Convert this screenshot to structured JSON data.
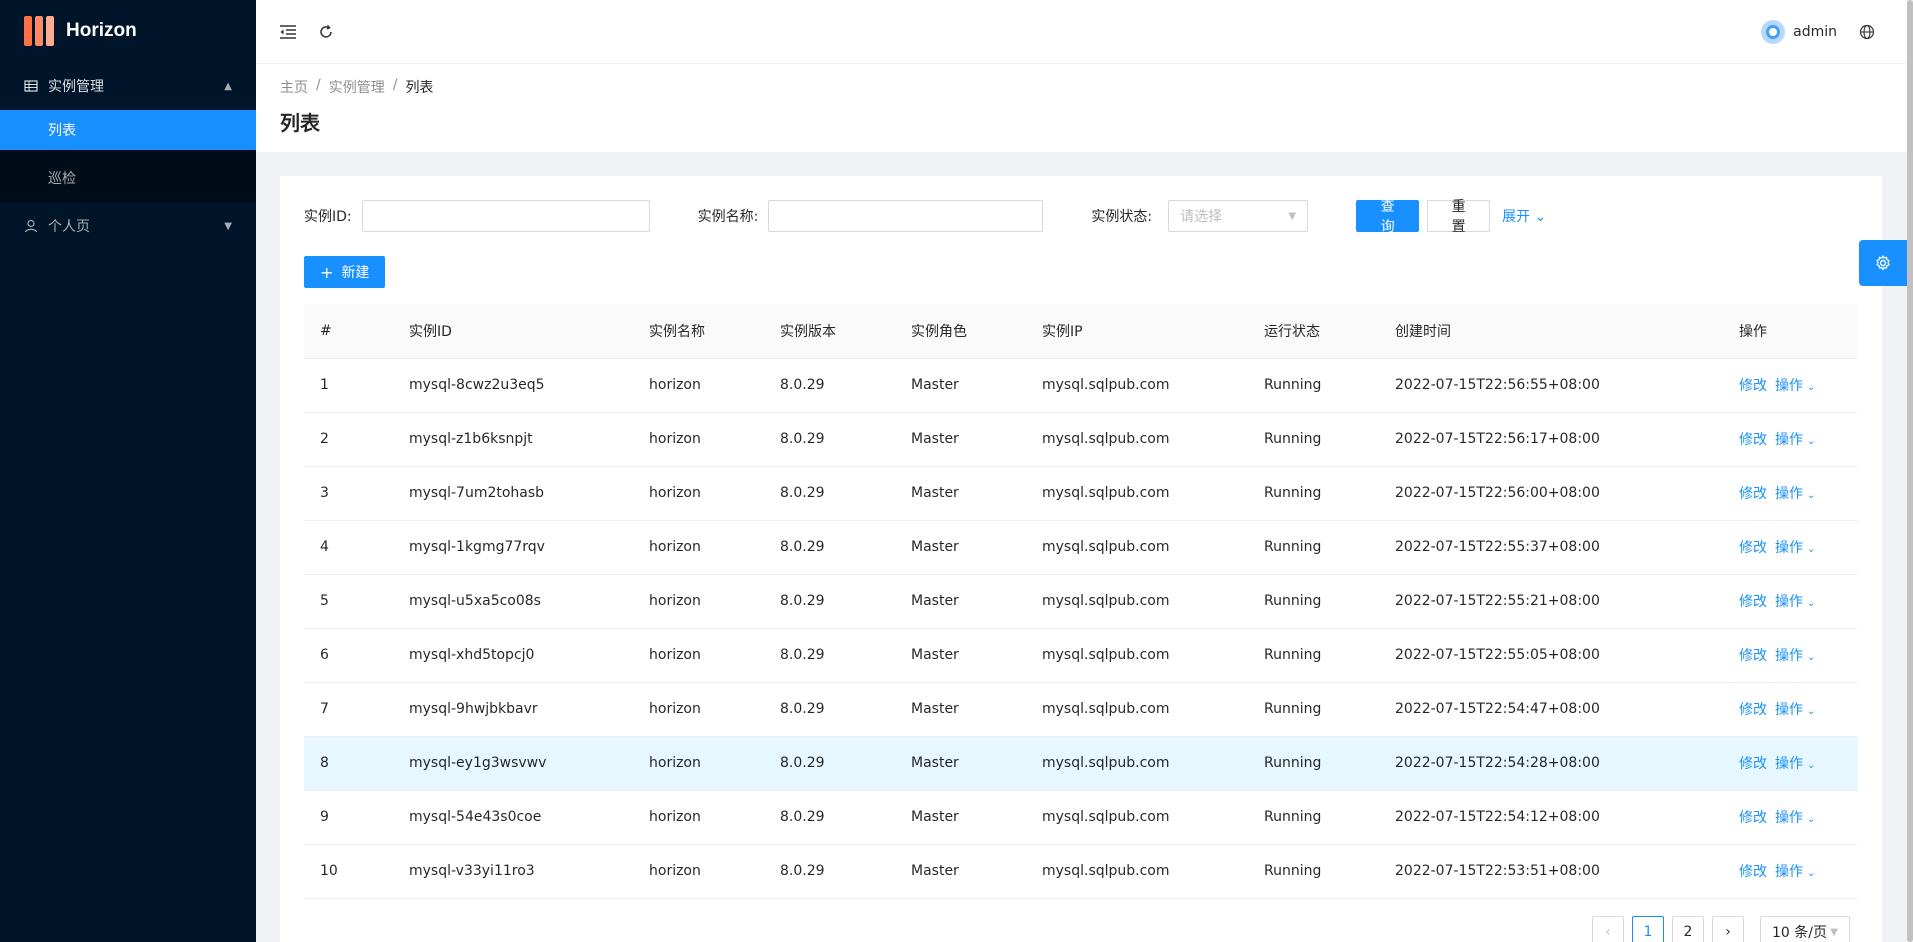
{
  "app": {
    "name": "Horizon"
  },
  "sidebar": {
    "groups": [
      {
        "label": "实例管理",
        "children": [
          {
            "label": "列表"
          },
          {
            "label": "巡检"
          }
        ]
      },
      {
        "label": "个人页"
      }
    ]
  },
  "header": {
    "username": "admin"
  },
  "breadcrumb": [
    "主页",
    "实例管理",
    "列表"
  ],
  "page": {
    "title": "列表"
  },
  "filters": {
    "instance_id_label": "实例ID:",
    "instance_name_label": "实例名称:",
    "status_label": "实例状态:",
    "status_placeholder": "请选择",
    "query_button": "查 询",
    "reset_button": "重 置",
    "expand_link": "展开"
  },
  "toolbar": {
    "new_button": "新建"
  },
  "table": {
    "columns": [
      "#",
      "实例ID",
      "实例名称",
      "实例版本",
      "实例角色",
      "实例IP",
      "运行状态",
      "创建时间",
      "操作"
    ],
    "rows": [
      {
        "no": "1",
        "id": "mysql-8cwz2u3eq5",
        "name": "horizon",
        "version": "8.0.29",
        "role": "Master",
        "ip": "mysql.sqlpub.com",
        "status": "Running",
        "created": "2022-07-15T22:56:55+08:00"
      },
      {
        "no": "2",
        "id": "mysql-z1b6ksnpjt",
        "name": "horizon",
        "version": "8.0.29",
        "role": "Master",
        "ip": "mysql.sqlpub.com",
        "status": "Running",
        "created": "2022-07-15T22:56:17+08:00"
      },
      {
        "no": "3",
        "id": "mysql-7um2tohasb",
        "name": "horizon",
        "version": "8.0.29",
        "role": "Master",
        "ip": "mysql.sqlpub.com",
        "status": "Running",
        "created": "2022-07-15T22:56:00+08:00"
      },
      {
        "no": "4",
        "id": "mysql-1kgmg77rqv",
        "name": "horizon",
        "version": "8.0.29",
        "role": "Master",
        "ip": "mysql.sqlpub.com",
        "status": "Running",
        "created": "2022-07-15T22:55:37+08:00"
      },
      {
        "no": "5",
        "id": "mysql-u5xa5co08s",
        "name": "horizon",
        "version": "8.0.29",
        "role": "Master",
        "ip": "mysql.sqlpub.com",
        "status": "Running",
        "created": "2022-07-15T22:55:21+08:00"
      },
      {
        "no": "6",
        "id": "mysql-xhd5topcj0",
        "name": "horizon",
        "version": "8.0.29",
        "role": "Master",
        "ip": "mysql.sqlpub.com",
        "status": "Running",
        "created": "2022-07-15T22:55:05+08:00"
      },
      {
        "no": "7",
        "id": "mysql-9hwjbkbavr",
        "name": "horizon",
        "version": "8.0.29",
        "role": "Master",
        "ip": "mysql.sqlpub.com",
        "status": "Running",
        "created": "2022-07-15T22:54:47+08:00"
      },
      {
        "no": "8",
        "id": "mysql-ey1g3wsvwv",
        "name": "horizon",
        "version": "8.0.29",
        "role": "Master",
        "ip": "mysql.sqlpub.com",
        "status": "Running",
        "created": "2022-07-15T22:54:28+08:00"
      },
      {
        "no": "9",
        "id": "mysql-54e43s0coe",
        "name": "horizon",
        "version": "8.0.29",
        "role": "Master",
        "ip": "mysql.sqlpub.com",
        "status": "Running",
        "created": "2022-07-15T22:54:12+08:00"
      },
      {
        "no": "10",
        "id": "mysql-v33yi11ro3",
        "name": "horizon",
        "version": "8.0.29",
        "role": "Master",
        "ip": "mysql.sqlpub.com",
        "status": "Running",
        "created": "2022-07-15T22:53:51+08:00"
      }
    ],
    "row_actions": {
      "edit": "修改",
      "more": "操作"
    },
    "highlighted_row": 8
  },
  "pagination": {
    "pages": [
      "1",
      "2"
    ],
    "current": "1",
    "page_size": "10 条/页"
  },
  "colors": {
    "primary": "#1890ff",
    "sider_bg": "#001529",
    "logo": "#ff7043"
  },
  "icons": [
    "menu-fold-icon",
    "reload-icon",
    "globe-icon",
    "table-icon",
    "user-icon",
    "plus-icon",
    "setting-icon"
  ]
}
